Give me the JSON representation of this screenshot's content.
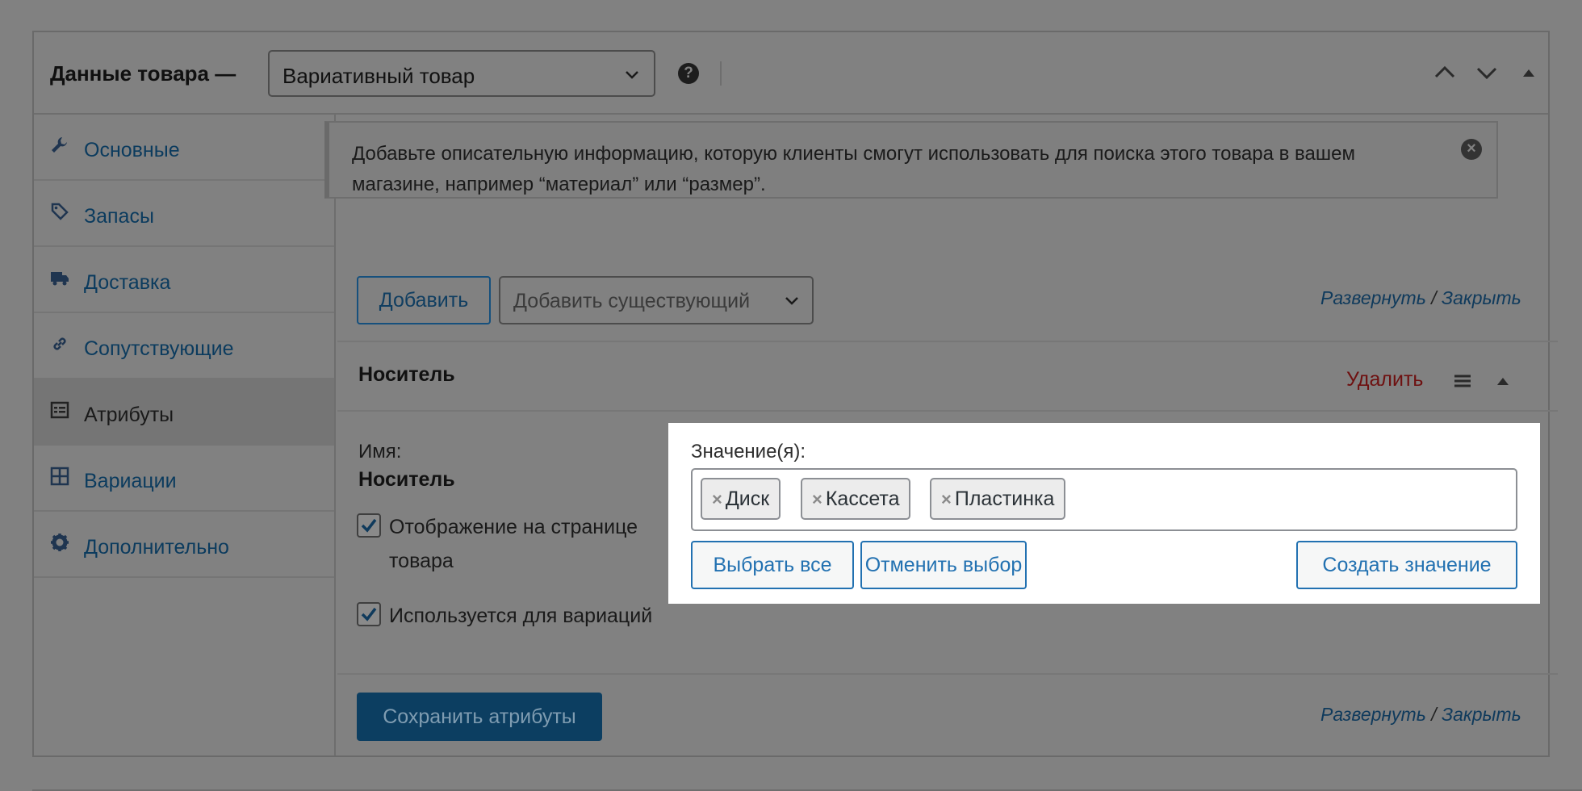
{
  "header": {
    "title": "Данные товара —",
    "product_type": "Вариативный товар",
    "help": "?"
  },
  "sidebar": {
    "items": [
      {
        "label": "Основные",
        "icon": "wrench-icon"
      },
      {
        "label": "Запасы",
        "icon": "tags-icon"
      },
      {
        "label": "Доставка",
        "icon": "truck-icon"
      },
      {
        "label": "Сопутствующие",
        "icon": "link-icon"
      },
      {
        "label": "Атрибуты",
        "icon": "list-view-icon"
      },
      {
        "label": "Вариации",
        "icon": "grid-icon"
      },
      {
        "label": "Дополнительно",
        "icon": "gear-icon"
      }
    ],
    "active_index": 4
  },
  "notice": {
    "text": "Добавьте описательную информацию, которую клиенты смогут использовать для поиска этого товара в вашем магазине, например “материал” или “размер”.",
    "close": "×"
  },
  "toolbar": {
    "add_label": "Добавить",
    "add_existing_label": "Добавить существующий",
    "expand_label": "Развернуть",
    "separator": "/",
    "close_label": "Закрыть"
  },
  "attribute": {
    "title": "Носитель",
    "remove_label": "Удалить",
    "name_label": "Имя:",
    "name_value": "Носитель",
    "visible_label": "Отображение на странице товара",
    "visible_checked": true,
    "variation_label": "Используется для вариаций",
    "variation_checked": true,
    "values_label": "Значение(я):",
    "values": [
      "Диск",
      "Кассета",
      "Пластинка"
    ],
    "select_all_label": "Выбрать все",
    "deselect_label": "Отменить выбор",
    "create_value_label": "Создать значение",
    "chip_remove": "×"
  },
  "footer": {
    "save_label": "Сохранить атрибуты",
    "expand_label": "Развернуть",
    "separator": "/",
    "close_label": "Закрыть"
  }
}
